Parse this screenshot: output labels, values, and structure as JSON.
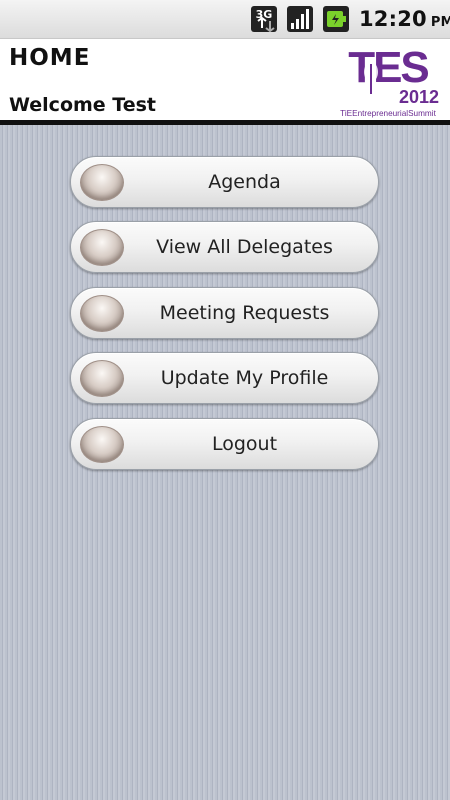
{
  "status_bar": {
    "network_icon": "3g-data-icon",
    "signal_icon": "signal-strength-icon",
    "battery_icon": "battery-charging-icon",
    "time": "12:20",
    "ampm": "PM"
  },
  "header": {
    "title": "HOME",
    "welcome": "Welcome Test",
    "logo": {
      "letters": "TES",
      "year": "2012",
      "tagline": "TiEEntrepreneurialSummit",
      "color": "#6a2c91"
    }
  },
  "menu": {
    "items": [
      {
        "label": "Agenda",
        "icon": "bullet-icon"
      },
      {
        "label": "View All Delegates",
        "icon": "bullet-icon"
      },
      {
        "label": "Meeting Requests",
        "icon": "bullet-icon"
      },
      {
        "label": "Update My Profile",
        "icon": "bullet-icon"
      },
      {
        "label": "Logout",
        "icon": "bullet-icon"
      }
    ]
  }
}
